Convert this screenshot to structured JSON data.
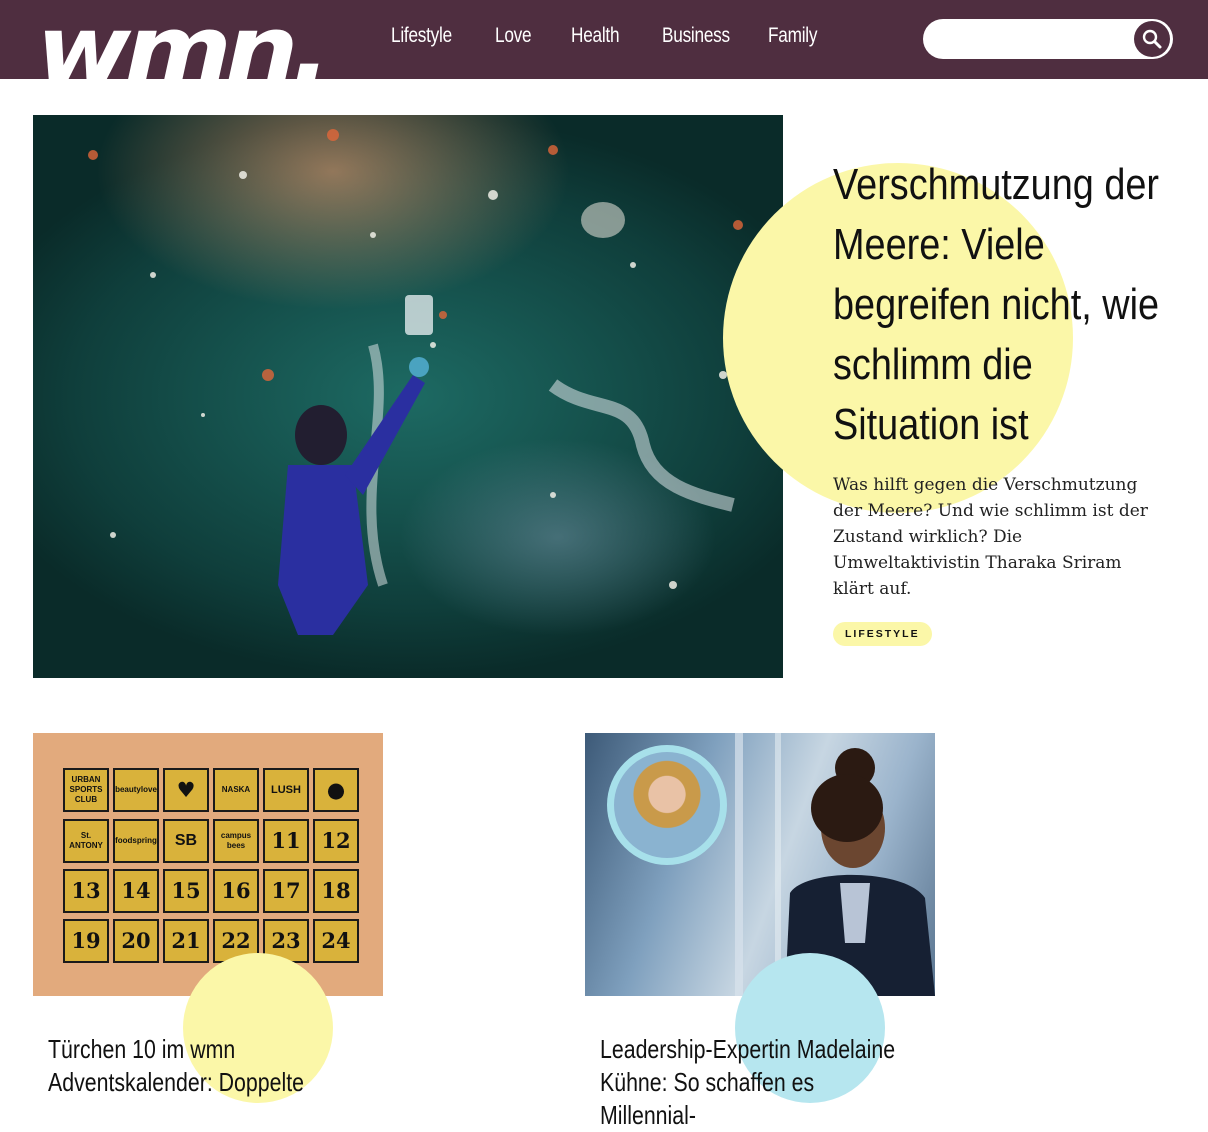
{
  "header": {
    "logo_text": "wmn.",
    "nav": [
      {
        "label": "Lifestyle"
      },
      {
        "label": "Love"
      },
      {
        "label": "Health"
      },
      {
        "label": "Business"
      },
      {
        "label": "Family"
      }
    ],
    "search": {
      "value": "",
      "placeholder": ""
    }
  },
  "hero": {
    "title": "Verschmutzung der Meere: Viele begreifen nicht, wie schlimm die Situation ist",
    "description": "Was hilft gegen die Verschmutzung der Meere? Und wie schlimm ist der Zustand wirklich? Die Umweltaktivistin Tharaka Sriram klärt auf.",
    "tag": "LIFESTYLE"
  },
  "advent": {
    "tiles": [
      "URBAN SPORTS CLUB",
      "beautylove",
      "",
      "NASKA",
      "LUSH",
      "",
      "St. ANTONY",
      "foodspring",
      "SB",
      "campus bees",
      "11",
      "12",
      "13",
      "14",
      "15",
      "16",
      "17",
      "18",
      "19",
      "20",
      "21",
      "22",
      "23",
      "24"
    ]
  },
  "cards": [
    {
      "title": "Türchen 10 im wmn Adventskalender: Doppelte"
    },
    {
      "title": "Leadership-Expertin Madelaine Kühne: So schaffen es Millennial-"
    }
  ],
  "colors": {
    "header_bg": "#4f2e40",
    "accent_yellow": "#fbf7a8",
    "accent_blue": "#b6e6ef"
  }
}
